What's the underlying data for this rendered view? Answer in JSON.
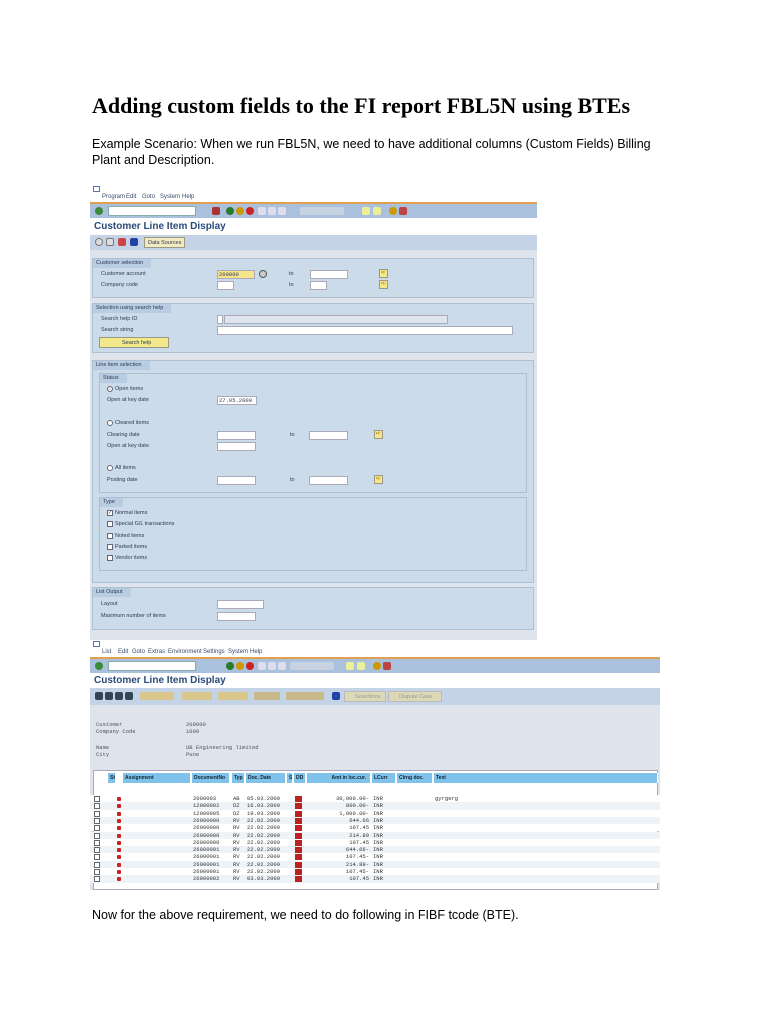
{
  "doc": {
    "title": "Adding custom fields to the FI report FBL5N using BTEs",
    "intro": "Example Scenario: When we run FBL5N, we need to have additional columns (Custom Fields) Billing Plant and Description.",
    "outro": "Now for the above requirement, we need to do following in FIBF tcode (BTE)."
  },
  "shot1": {
    "menu": [
      "Program",
      "Edit",
      "Goto",
      "System",
      "Help"
    ],
    "title": "Customer Line Item Display",
    "data_sources": "Data Sources",
    "cust_sel": {
      "title": "Customer selection",
      "account_label": "Customer account",
      "account_value": "200000",
      "company_label": "Company code",
      "to": "to"
    },
    "search": {
      "title": "Selection using search help",
      "id_label": "Search help ID",
      "string_label": "Search string",
      "button": "Search help"
    },
    "lis": {
      "title": "Line item selection",
      "status": "Status",
      "open_items": "Open items",
      "open_key_date": "Open at key date",
      "open_key_value": "27.05.2009",
      "cleared_items": "Cleared items",
      "clearing_date": "Clearing date",
      "open_key_date2": "Open at key date",
      "all_items": "All items",
      "posting_date": "Posting date",
      "to": "to",
      "type": "Type",
      "types": [
        "Normal items",
        "Special G/L transactions",
        "Noted items",
        "Parked items",
        "Vendor items"
      ]
    },
    "list_output": {
      "title": "List Output",
      "layout": "Layout",
      "max": "Maximum number of items"
    }
  },
  "shot2": {
    "menu": [
      "List",
      "Edit",
      "Goto",
      "Extras",
      "Environment",
      "Settings",
      "System",
      "Help"
    ],
    "title": "Customer Line Item Display",
    "selections": "Selections",
    "dispute": "Dispute Case",
    "info": {
      "customer_label": "Customer",
      "customer": "200000",
      "cc_label": "Company Code",
      "cc": "1000",
      "name_label": "Name",
      "name": "UB Engineering limited",
      "city_label": "City",
      "city": "Pune"
    },
    "columns": [
      "St",
      "Assignment",
      "DocumentNo",
      "Typ",
      "Doc. Date",
      "S",
      "DD",
      "Amt in loc.cur.",
      "LCurr",
      "Clrng doc.",
      "Text"
    ],
    "rows": [
      [
        "2000003",
        "AB",
        "05.03.2009",
        "30,000.00-",
        "INR",
        "gyrgerg"
      ],
      [
        "12000002",
        "DZ",
        "16.03.2009",
        "800.00-",
        "INR",
        ""
      ],
      [
        "12000005",
        "DZ",
        "19.03.2009",
        "1,000.00-",
        "INR",
        ""
      ],
      [
        "26000000",
        "RV",
        "22.02.2009",
        "644.66",
        "INR",
        ""
      ],
      [
        "26000000",
        "RV",
        "22.02.2009",
        "107.45",
        "INR",
        ""
      ],
      [
        "26000000",
        "RV",
        "22.02.2009",
        "214.89",
        "INR",
        ""
      ],
      [
        "26000000",
        "RV",
        "22.02.2009",
        "107.45",
        "INR",
        ""
      ],
      [
        "26000001",
        "RV",
        "22.02.2009",
        "644.66-",
        "INR",
        ""
      ],
      [
        "26000001",
        "RV",
        "22.02.2009",
        "107.45-",
        "INR",
        ""
      ],
      [
        "26000001",
        "RV",
        "22.02.2009",
        "214.89-",
        "INR",
        ""
      ],
      [
        "26000001",
        "RV",
        "22.02.2009",
        "107.45-",
        "INR",
        ""
      ],
      [
        "26000002",
        "RV",
        "03.03.2009",
        "107.45",
        "INR",
        ""
      ]
    ]
  }
}
